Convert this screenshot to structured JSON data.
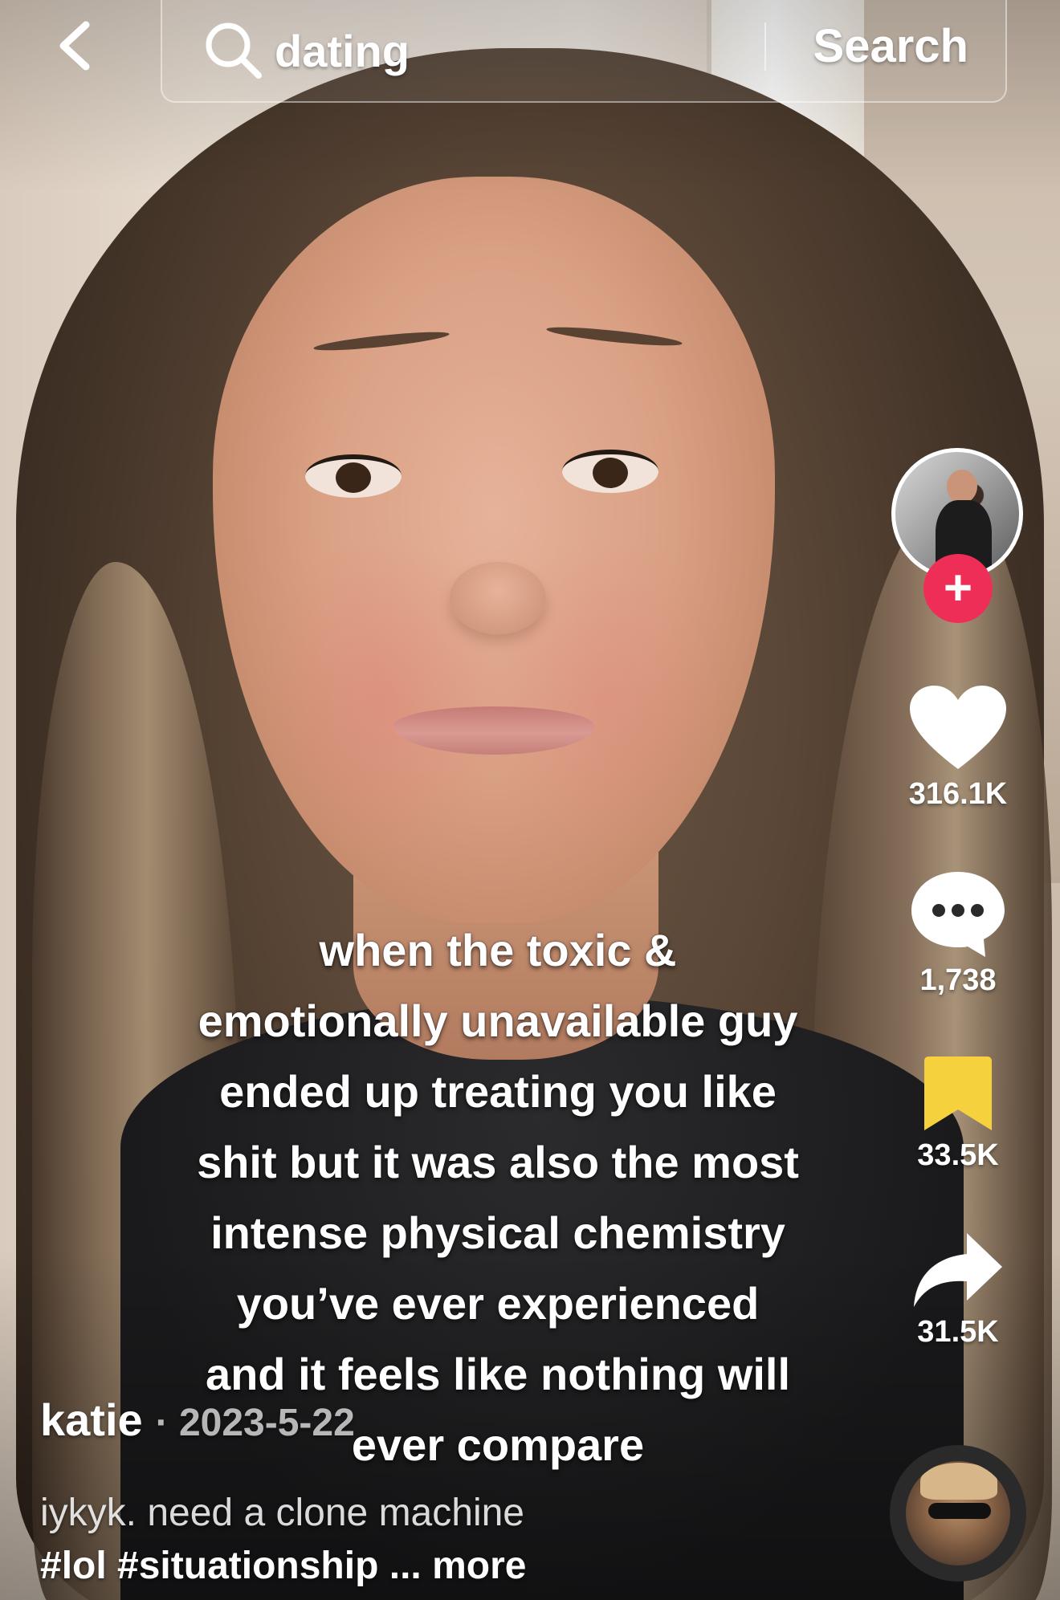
{
  "search": {
    "query": "dating",
    "button_label": "Search"
  },
  "icons": {
    "back": "chevron-left-icon",
    "search": "search-icon",
    "like": "heart-icon",
    "comment": "comment-bubble-icon",
    "save": "bookmark-icon",
    "share": "share-arrow-icon",
    "follow": "plus-icon"
  },
  "colors": {
    "follow_red": "#ee2e56",
    "bookmark_yellow": "#f6d13e",
    "text": "#ffffff"
  },
  "actions": {
    "follow_symbol": "+",
    "likes": "316.1K",
    "comments": "1,738",
    "saves": "33.5K",
    "shares": "31.5K"
  },
  "overlay_caption": "when the toxic &\nemotionally unavailable guy\nended up treating you like\nshit but it was also the most\nintense physical chemistry\nyou’ve ever experienced\nand it feels like nothing will\never compare",
  "post": {
    "username": "katie",
    "date": "· 2023-5-22",
    "description": "iykyk. need a clone machine",
    "hashtags": [
      "#lol",
      "#situationship"
    ],
    "ellipsis": "...",
    "more_label": "more"
  }
}
